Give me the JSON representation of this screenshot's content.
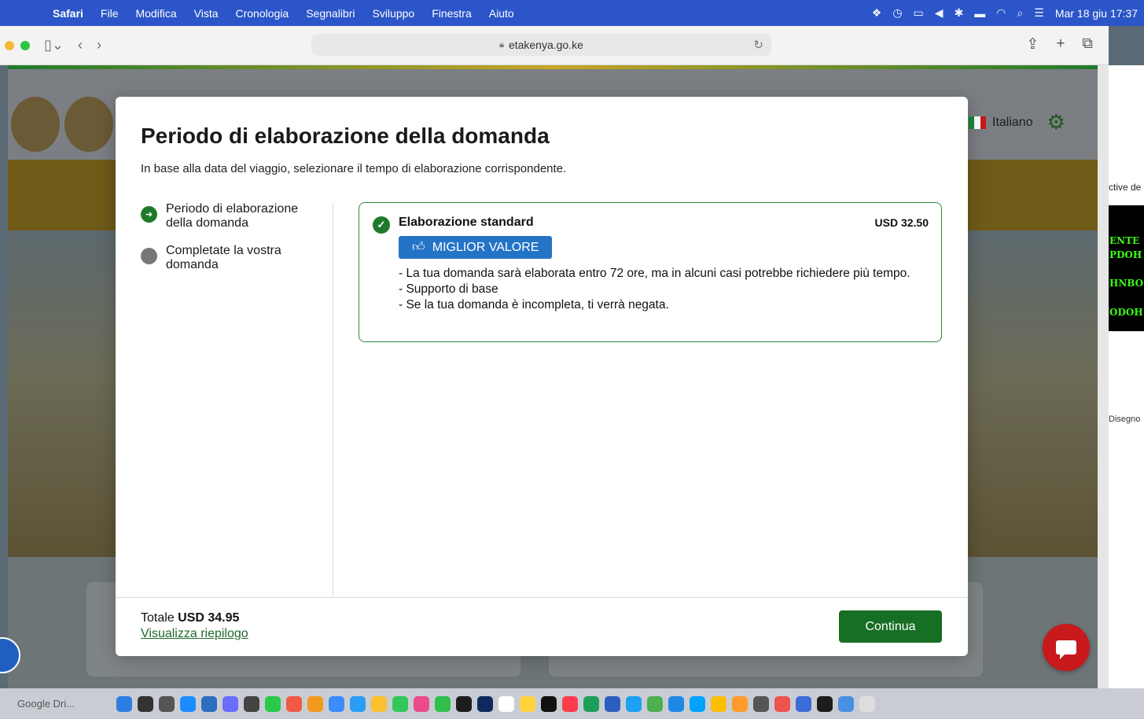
{
  "menubar": {
    "apple": "",
    "items": [
      "Safari",
      "File",
      "Modifica",
      "Vista",
      "Cronologia",
      "Segnalibri",
      "Sviluppo",
      "Finestra",
      "Aiuto"
    ],
    "clock": "Mar 18 giu 17:37"
  },
  "browser": {
    "url": "etakenya.go.ke"
  },
  "site": {
    "language": "Italiano"
  },
  "sidewin": {
    "text1": "ctive de",
    "green_lines": [
      "ENTE",
      "PDOH",
      "HNBO",
      "ODOH"
    ],
    "draw_label": "Disegno"
  },
  "modal": {
    "title": "Periodo di elaborazione della domanda",
    "subtitle": "In base alla data del viaggio, selezionare il tempo di elaborazione corrispondente.",
    "steps": [
      {
        "label": "Periodo di elaborazione della domanda",
        "state": "active"
      },
      {
        "label": "Completate la vostra domanda",
        "state": "inactive"
      }
    ],
    "option": {
      "name": "Elaborazione standard",
      "price": "USD 32.50",
      "badge": "MIGLIOR VALORE",
      "lines": [
        "- La tua domanda sarà elaborata entro 72 ore, ma in alcuni casi potrebbe richiedere più tempo.",
        "- Supporto di base",
        "- Se la tua domanda è incompleta, ti verrà negata."
      ]
    },
    "footer": {
      "total_label": "Totale",
      "total_value": "USD 34.95",
      "summary_link": "Visualizza riepilogo",
      "continue": "Continua"
    }
  },
  "dock": {
    "first_item": "Google Dri..."
  },
  "colors": {
    "primary_green": "#176e25",
    "badge_blue": "#2374c6",
    "menubar_blue": "#2b55c8",
    "chat_red": "#c8191c"
  }
}
